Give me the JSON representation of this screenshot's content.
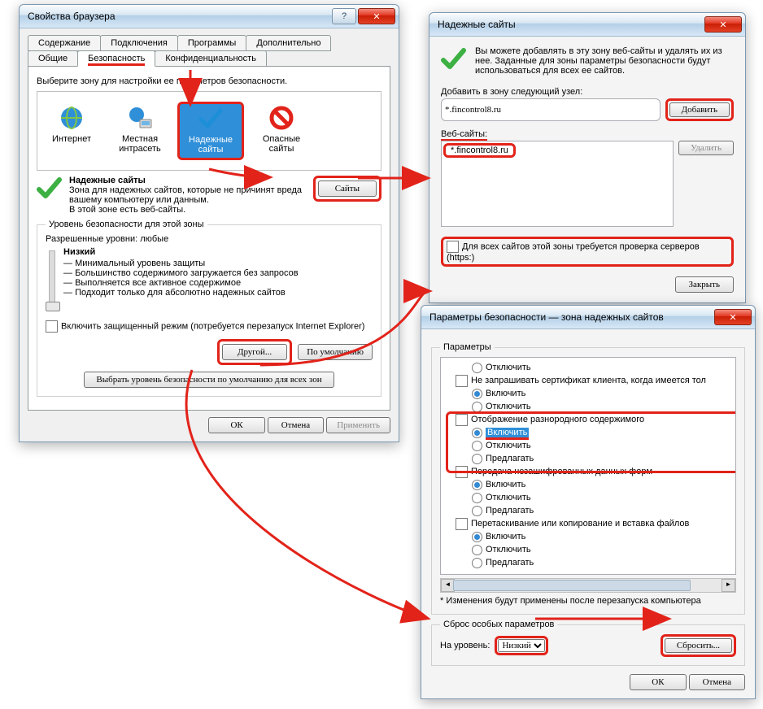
{
  "win1": {
    "title": "Свойства браузера",
    "tabs_row1": [
      "Содержание",
      "Подключения",
      "Программы",
      "Дополнительно"
    ],
    "tabs_row2": [
      "Общие",
      "Безопасность",
      "Конфиденциальность"
    ],
    "zone_prompt": "Выберите зону для настройки ее параметров безопасности.",
    "zones": [
      {
        "label": "Интернет"
      },
      {
        "label": "Местная интрасеть"
      },
      {
        "label": "Надежные сайты"
      },
      {
        "label": "Опасные сайты"
      }
    ],
    "trusted_title": "Надежные сайты",
    "trusted_desc": "Зона для надежных сайтов, которые не причинят вреда вашему компьютеру или данным.",
    "trusted_has": "В этой зоне есть веб-сайты.",
    "sites_btn": "Сайты",
    "level_legend": "Уровень безопасности для этой зоны",
    "level_allowed": "Разрешенные уровни: любые",
    "level_name": "Низкий",
    "level_bullets": [
      "Минимальный уровень защиты",
      "Большинство содержимого загружается без запросов",
      "Выполняется все активное содержимое",
      "Подходит только для абсолютно надежных сайтов"
    ],
    "protected_mode": "Включить защищенный режим (потребуется перезапуск Internet Explorer)",
    "custom_btn": "Другой...",
    "default_btn": "По умолчанию",
    "reset_all": "Выбрать уровень безопасности по умолчанию для всех зон",
    "ok": "ОК",
    "cancel": "Отмена",
    "apply": "Применить"
  },
  "win2": {
    "title": "Надежные сайты",
    "intro": "Вы можете добавлять в эту зону  веб-сайты и удалять их из нее. Заданные для зоны параметры безопасности будут использоваться для всех ее сайтов.",
    "add_label": "Добавить в зону следующий узел:",
    "add_value": "*.fincontrol8.ru",
    "add_btn": "Добавить",
    "sites_label": "Веб-сайты:",
    "site_item": "*.fincontrol8.ru",
    "remove_btn": "Удалить",
    "https_check": "Для всех сайтов этой зоны требуется проверка серверов (https:)",
    "close_btn": "Закрыть"
  },
  "win3": {
    "title": "Параметры безопасности — зона надежных сайтов",
    "params_legend": "Параметры",
    "options": [
      {
        "type": "radio",
        "state": "off",
        "label": "Отключить"
      },
      {
        "type": "group",
        "state": "",
        "label": "Не запрашивать сертификат клиента, когда имеется тол"
      },
      {
        "type": "radio",
        "state": "on",
        "label": "Включить"
      },
      {
        "type": "radio",
        "state": "off",
        "label": "Отключить"
      },
      {
        "type": "group",
        "state": "",
        "label": "Отображение разнородного содержимого"
      },
      {
        "type": "radio",
        "state": "on",
        "label": "Включить",
        "hl": true
      },
      {
        "type": "radio",
        "state": "off",
        "label": "Отключить"
      },
      {
        "type": "radio",
        "state": "off",
        "label": "Предлагать"
      },
      {
        "type": "group",
        "state": "",
        "label": "Передача незашифрованных данных форм"
      },
      {
        "type": "radio",
        "state": "on",
        "label": "Включить"
      },
      {
        "type": "radio",
        "state": "off",
        "label": "Отключить"
      },
      {
        "type": "radio",
        "state": "off",
        "label": "Предлагать"
      },
      {
        "type": "group",
        "state": "",
        "label": "Перетаскивание или копирование и вставка файлов"
      },
      {
        "type": "radio",
        "state": "on",
        "label": "Включить"
      },
      {
        "type": "radio",
        "state": "off",
        "label": "Отключить"
      },
      {
        "type": "radio",
        "state": "off",
        "label": "Предлагать"
      }
    ],
    "restart_note": "* Изменения будут применены после перезапуска компьютера",
    "reset_legend": "Сброс особых параметров",
    "reset_label": "На уровень:",
    "reset_value": "Низкий",
    "reset_btn": "Сбросить...",
    "ok": "ОК",
    "cancel": "Отмена"
  }
}
